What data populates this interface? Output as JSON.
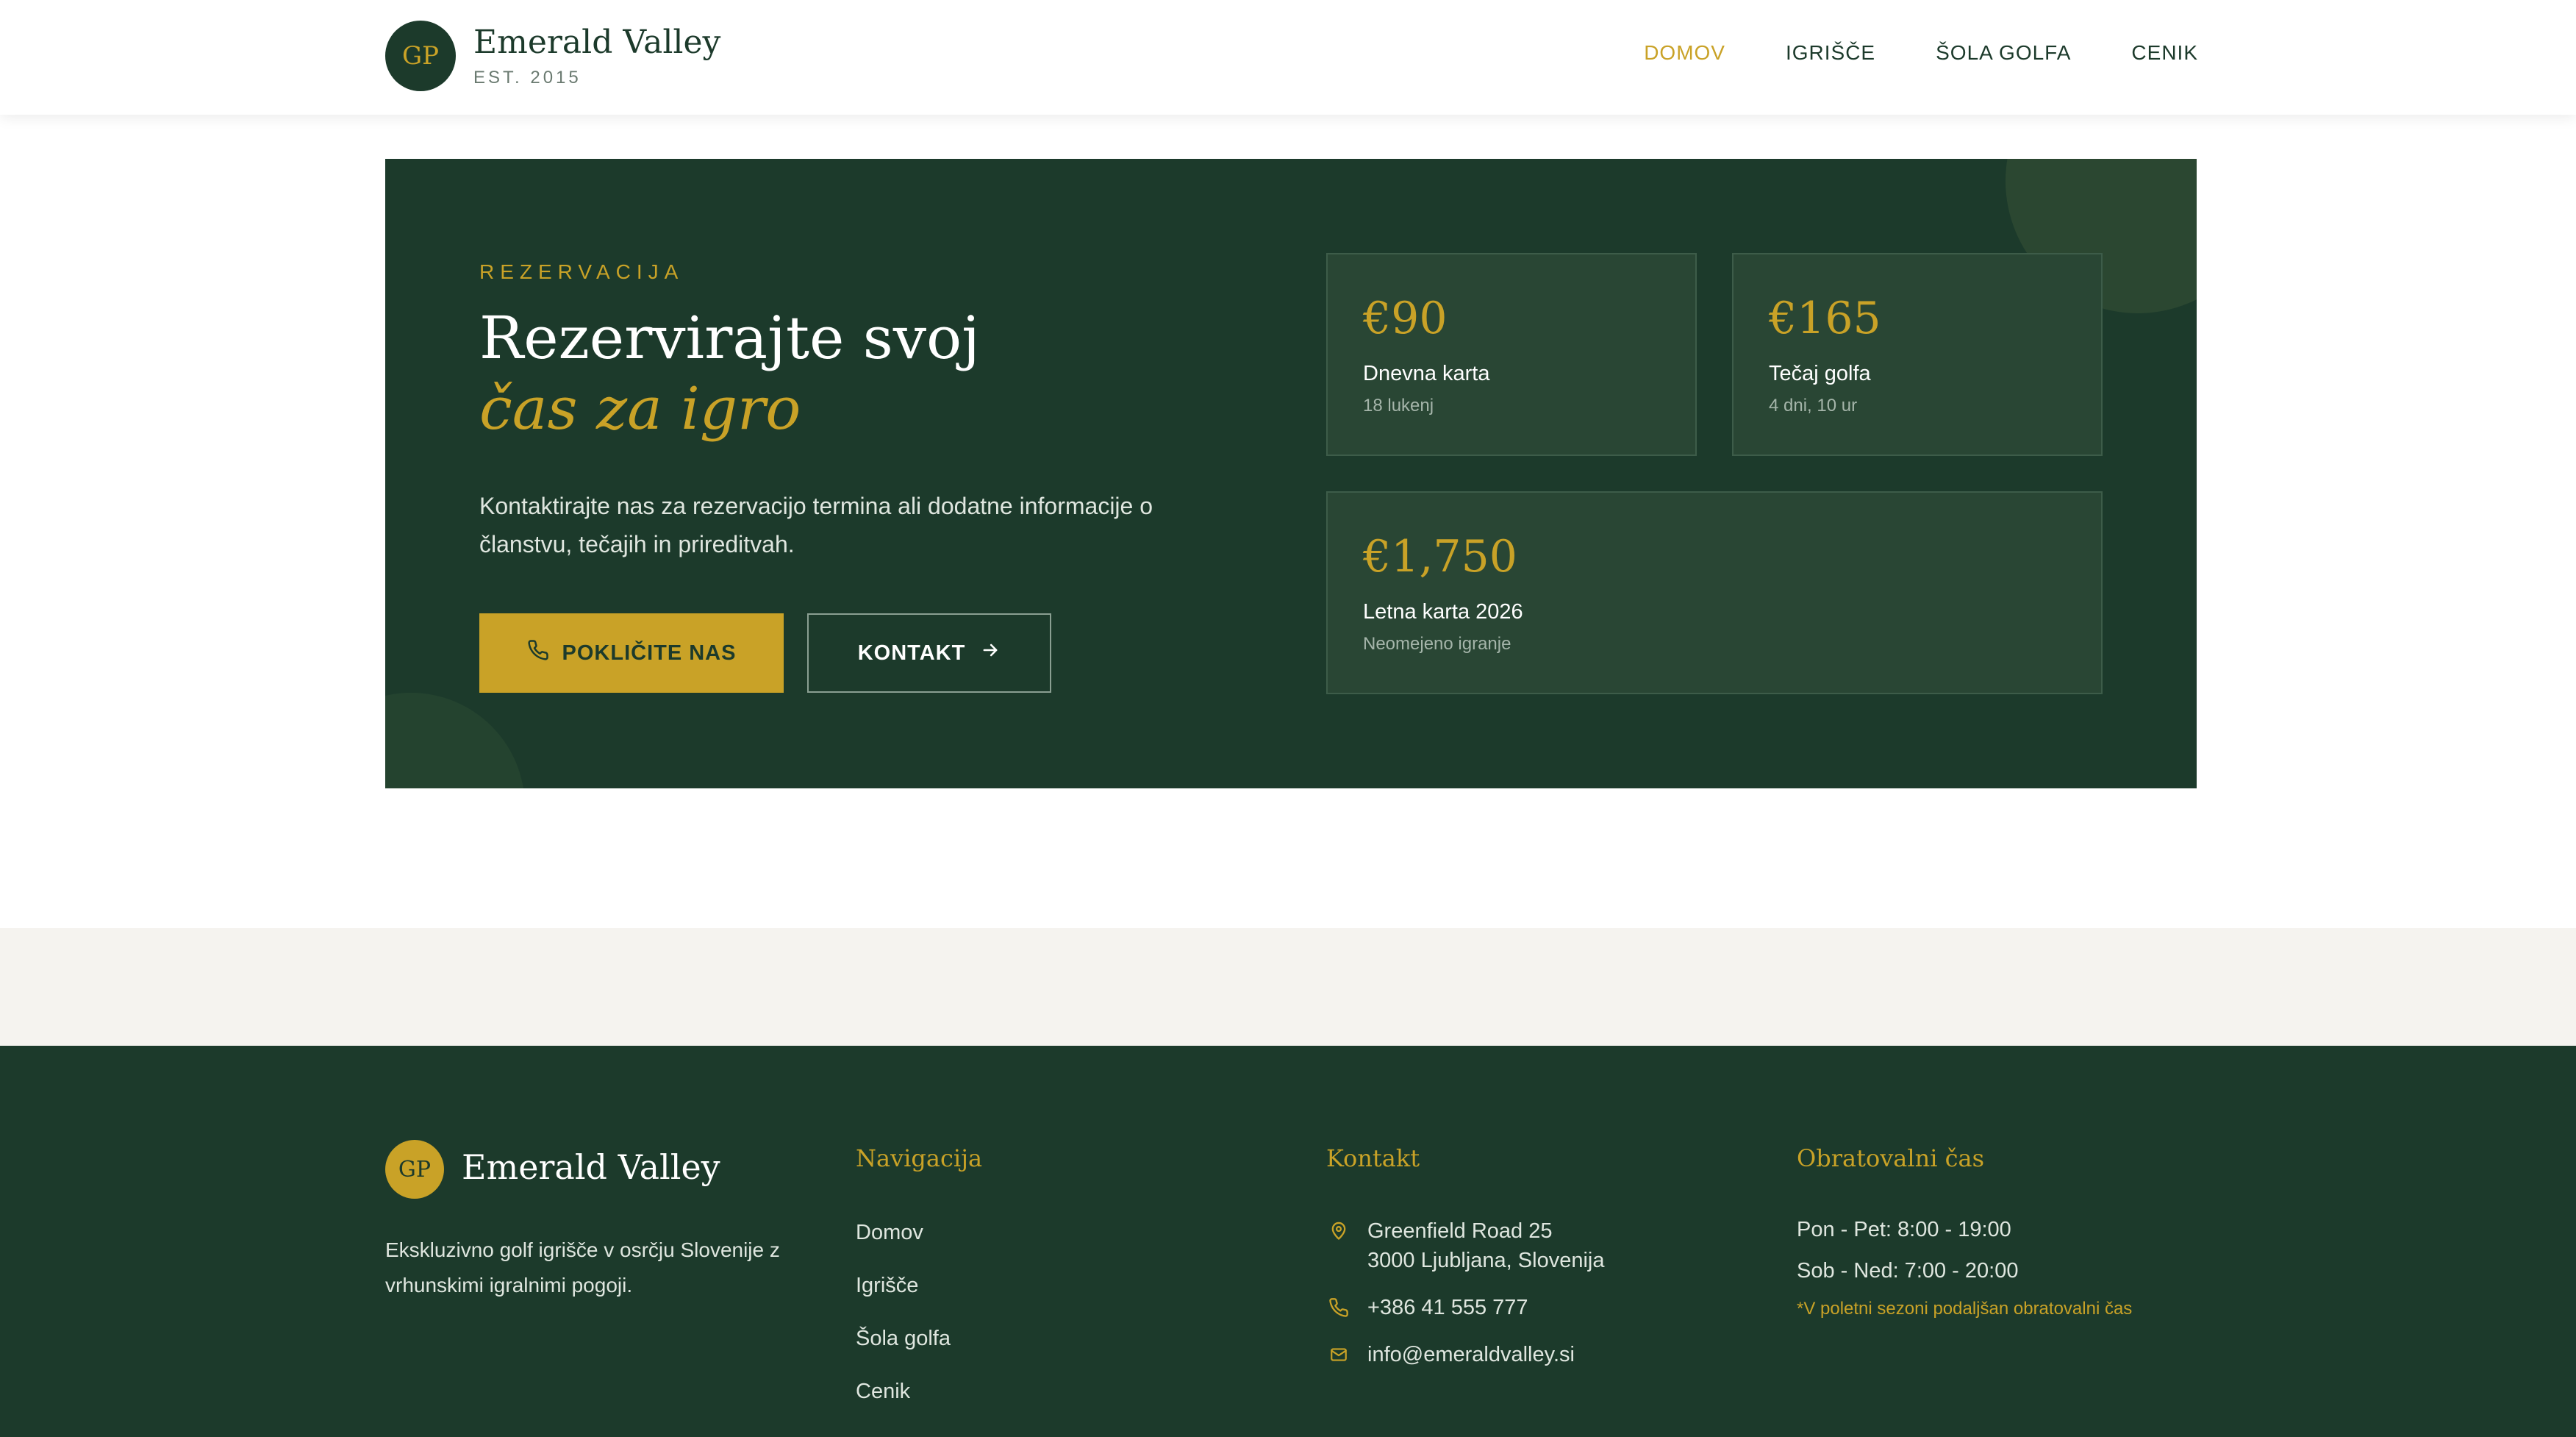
{
  "header": {
    "logo_initials": "GP",
    "brand_name": "Emerald Valley",
    "established": "EST. 2015",
    "nav": [
      {
        "label": "DOMOV",
        "active": true
      },
      {
        "label": "IGRIŠČE",
        "active": false
      },
      {
        "label": "ŠOLA GOLFA",
        "active": false
      },
      {
        "label": "CENIK",
        "active": false
      }
    ]
  },
  "hero": {
    "eyebrow": "REZERVACIJA",
    "title_line1": "Rezervirajte svoj",
    "title_line2": "čas za igro",
    "description": "Kontaktirajte nas za rezervacijo termina ali dodatne informacije o članstvu, tečajih in prireditvah.",
    "call_button": "POKLIČITE NAS",
    "contact_button": "KONTAKT",
    "prices": [
      {
        "price": "€90",
        "label": "Dnevna karta",
        "sub": "18 lukenj"
      },
      {
        "price": "€165",
        "label": "Tečaj golfa",
        "sub": "4 dni, 10 ur"
      },
      {
        "price": "€1,750",
        "label": "Letna karta 2026",
        "sub": "Neomejeno igranje"
      }
    ]
  },
  "footer": {
    "logo_initials": "GP",
    "brand_name": "Emerald Valley",
    "description": "Ekskluzivno golf igrišče v osrčju Slovenije z vrhunskimi igralnimi pogoji.",
    "nav_heading": "Navigacija",
    "nav_links": [
      "Domov",
      "Igrišče",
      "Šola golfa",
      "Cenik"
    ],
    "contact_heading": "Kontakt",
    "address_line1": "Greenfield Road 25",
    "address_line2": "3000 Ljubljana, Slovenija",
    "phone": "+386 41 555 777",
    "email": "info@emeraldvalley.si",
    "hours_heading": "Obratovalni čas",
    "hours_weekdays": "Pon - Pet: 8:00 - 19:00",
    "hours_weekend": "Sob - Ned: 7:00 - 20:00",
    "hours_note": "*V poletni sezoni podaljšan obratovalni čas"
  },
  "colors": {
    "primary_green": "#1c3a2b",
    "accent_gold": "#c9a227",
    "card_green": "#294634",
    "strip_beige": "#f5f3ef"
  },
  "icons": [
    "phone-icon",
    "arrow-right-icon",
    "location-pin-icon",
    "mail-icon"
  ]
}
